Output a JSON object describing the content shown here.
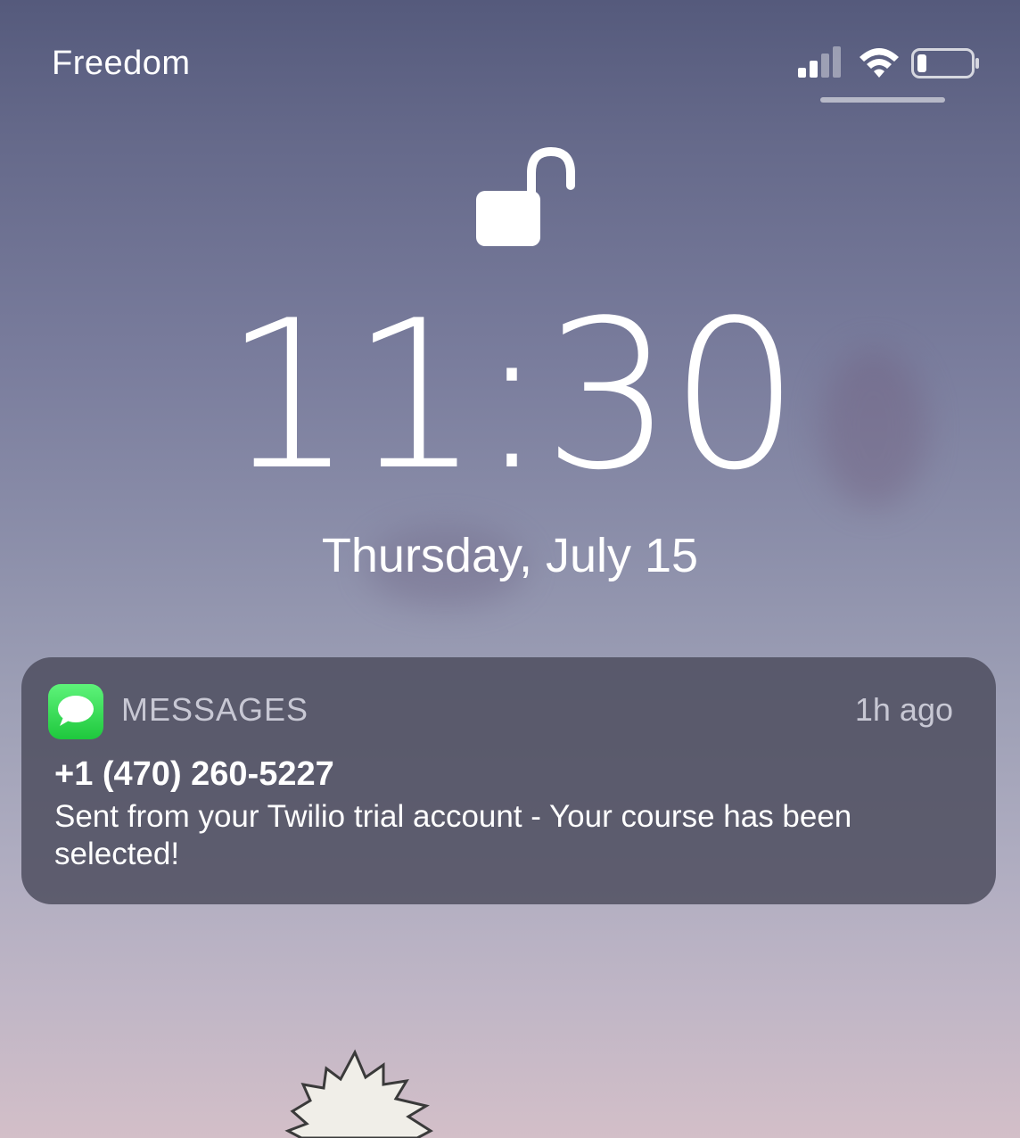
{
  "status_bar": {
    "carrier": "Freedom",
    "signal_icon": "cellular-signal-icon",
    "signal_bars_filled": 2,
    "signal_bars_total": 4,
    "wifi_icon": "wifi-icon",
    "battery_icon": "battery-icon",
    "battery_level": 0.15
  },
  "lock": {
    "icon": "unlocked-padlock-icon"
  },
  "clock": {
    "time": "11:30",
    "date": "Thursday, July 15"
  },
  "notification": {
    "app_icon": "messages-app-icon",
    "app_name": "MESSAGES",
    "time_ago": "1h ago",
    "sender": "+1 (470) 260-5227",
    "body": "Sent from your Twilio trial account - Your course has been selected!"
  },
  "colors": {
    "messages_green": "#2fd34a",
    "notification_bg": "#4a4a5c"
  }
}
